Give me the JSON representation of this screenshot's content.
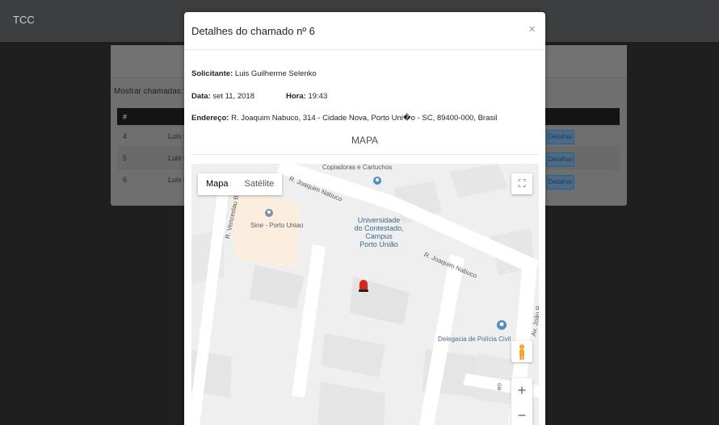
{
  "navbar": {
    "brand": "TCC"
  },
  "panel": {
    "show_label": "Mostrar chamadas:",
    "table_header": [
      "#",
      ""
    ],
    "rows": [
      {
        "id": "4",
        "name": "Luis G",
        "action": "Detalhar"
      },
      {
        "id": "5",
        "name": "Luis G",
        "action": "Detalhar"
      },
      {
        "id": "6",
        "name": "Luis G",
        "action": "Detalhar"
      }
    ]
  },
  "modal": {
    "title": "Detalhes do chamado nº 6",
    "close": "×",
    "solicitante_label": "Solicitante:",
    "solicitante": "Luis Guilherme Selenko",
    "data_label": "Data:",
    "data": "set 11, 2018",
    "hora_label": "Hora:",
    "hora": "19:43",
    "endereco_label": "Endereço:",
    "endereco": "R. Joaquim Nabuco, 314 - Cidade Nova, Porto Uni�o - SC, 89400-000, Brasil",
    "mapa_title": "MAPA"
  },
  "map": {
    "type_buttons": {
      "map": "Mapa",
      "satellite": "Satélite"
    },
    "fullscreen_icon": "fullscreen-icon",
    "zoom_in": "+",
    "zoom_out": "−",
    "labels": {
      "street_top": "R. Joaquim Nabuco",
      "street_right": "R. Joaquim Nabuco",
      "street_left": "R. Venceslau B",
      "street_av": "Av. João P",
      "street_bottom": "oa",
      "copiadoras": "Copiadoras e Cartuchos",
      "sine": "Sine - Porto Uniao",
      "universidade": "Universidade\ndo Contestado,\nCampus\nPorto União",
      "delegacia": "Delegacia de Polícia Civil"
    }
  },
  "colors": {
    "modal_bg": "#ffffff",
    "overlay": "#1e1e1e",
    "poi_blue": "#4e8fc0",
    "marker_red": "#d9261c"
  }
}
